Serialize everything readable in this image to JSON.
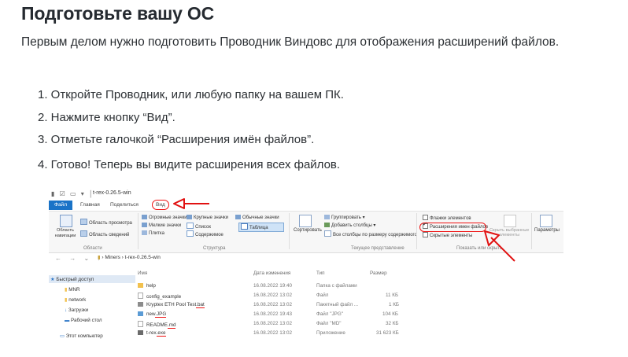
{
  "article": {
    "heading": "Подготовьте вашу ОС",
    "intro": "Первым делом нужно подготовить Проводник Виндовс для отображения расширений файлов.",
    "steps": [
      "1. Откройте Проводник, или любую папку на вашем ПК.",
      "2. Нажмите кнопку “Вид”.",
      "3. Отметьте галочкой “Расширения имён файлов”.",
      "4. Готово! Теперь вы видите расширения всех файлов."
    ]
  },
  "explorer": {
    "window_title": "t-rex-0.26.5-win",
    "tabs": [
      "Файл",
      "Главная",
      "Поделиться",
      "Вид"
    ],
    "ribbon": {
      "panes": {
        "nav_pane": "Область навигации",
        "preview_pane": "Область просмотра",
        "details_pane": "Область сведений",
        "group": "Области"
      },
      "layout": {
        "huge_icons": "Огромные значки",
        "large_icons": "Крупные значки",
        "normal_icons": "Обычные значки",
        "small_icons": "Мелкие значки",
        "list": "Список",
        "table": "Таблица",
        "tiles": "Плитка",
        "content": "Содержимое",
        "group": "Структура"
      },
      "current_view": {
        "sort": "Сортировать",
        "group_by": "Группировать",
        "add_columns": "Добавить столбцы",
        "fit_columns": "Все столбцы по размеру содержимого",
        "group": "Текущее представление"
      },
      "show_hide": {
        "item_checkboxes": "Флажки элементов",
        "file_extensions": "Расширения имен файлов",
        "hidden_items": "Скрытые элементы",
        "hide_selected_1": "Скрыть выбранные",
        "hide_selected_2": "элементы",
        "group": "Показать или скрыть"
      },
      "options": "Параметры"
    },
    "path": [
      "Miners",
      "t-rex-0.26.5-win"
    ],
    "sidebar": [
      "Быстрый доступ",
      "MNR",
      "network",
      "Загрузки",
      "Рабочий стол",
      "Этот компьютер"
    ],
    "columns": [
      "Имя",
      "Дата изменения",
      "Тип",
      "Размер"
    ],
    "files": [
      {
        "name": "help",
        "date": "16.08.2022 19:40",
        "type": "Папка с файлами",
        "size": ""
      },
      {
        "name": "config_example",
        "date": "16.08.2022 13:02",
        "type": "Файл",
        "size": "11 КБ"
      },
      {
        "name": "Kryptex ETH Pool Test.bat",
        "date": "16.08.2022 13:02",
        "type": "Пакетный файл ...",
        "size": "1 КБ"
      },
      {
        "name": "new.JPG",
        "date": "16.08.2022 19:43",
        "type": "Файл \"JPG\"",
        "size": "104 КБ"
      },
      {
        "name": "README.md",
        "date": "16.08.2022 13:02",
        "type": "Файл \"MD\"",
        "size": "32 КБ"
      },
      {
        "name": "t-rex.exe",
        "date": "16.08.2022 13:02",
        "type": "Приложение",
        "size": "31 623 КБ"
      }
    ],
    "file_name_stems": [
      "Kryptex ETH Pool Test",
      "new",
      "README",
      "t-rex"
    ],
    "file_name_exts": [
      ".bat",
      ".JPG",
      ".md",
      ".exe"
    ],
    "colors": {
      "file_tab": "#1a73c7",
      "annotation_red": "#e11111",
      "folder_yellow": "#f2c14e",
      "selection_blue": "#dfe9f5"
    }
  }
}
